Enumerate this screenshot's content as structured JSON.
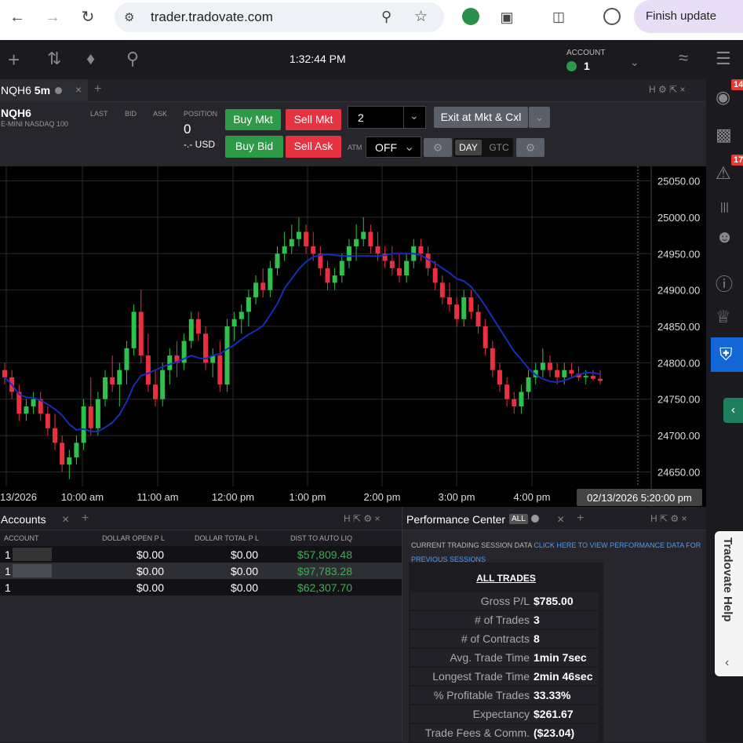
{
  "browser": {
    "url": "trader.tradovate.com",
    "finish_update": "Finish update"
  },
  "topbar": {
    "time": "1:32:44 PM",
    "account_label": "ACCOUNT",
    "account_value": "1"
  },
  "sidebar": {
    "badge_top": "14",
    "badge_mid": "17"
  },
  "chart_tab": {
    "symbol": "NQH6",
    "interval": "5m",
    "add": "+"
  },
  "order": {
    "symbol": "NQH6",
    "description": "E-MINI NASDAQ 100",
    "last_label": "LAST",
    "bid_label": "BID",
    "ask_label": "ASK",
    "position_label": "POSITION",
    "position_value": "0",
    "position_usd": "-.- USD",
    "buy_mkt": "Buy Mkt",
    "sell_mkt": "Sell Mkt",
    "buy_bid": "Buy Bid",
    "sell_ask": "Sell Ask",
    "qty": "2",
    "exit": "Exit at Mkt & Cxl",
    "atm_label": "ATM",
    "atm_value": "OFF",
    "day": "DAY",
    "gtc": "GTC"
  },
  "chart_data": {
    "type": "candlestick",
    "y_ticks": [
      "25050.00",
      "25000.00",
      "24950.00",
      "24900.00",
      "24850.00",
      "24800.00",
      "24750.00",
      "24700.00",
      "24650.00"
    ],
    "ylim": [
      24630,
      25070
    ],
    "x_ticks": [
      "13/2026",
      "10:00 am",
      "11:00 am",
      "12:00 pm",
      "1:00 pm",
      "2:00 pm",
      "3:00 pm",
      "4:00 pm"
    ],
    "crosshair_label": "02/13/2026 5:20:00 pm",
    "ma_color": "#1a2db8",
    "up_color": "#2ec24a",
    "down_color": "#e8303f",
    "candles": [
      [
        24790,
        24800,
        24770,
        24780
      ],
      [
        24780,
        24790,
        24750,
        24760
      ],
      [
        24760,
        24770,
        24720,
        24730
      ],
      [
        24730,
        24750,
        24720,
        24740
      ],
      [
        24740,
        24760,
        24730,
        24750
      ],
      [
        24750,
        24760,
        24720,
        24730
      ],
      [
        24730,
        24740,
        24700,
        24710
      ],
      [
        24710,
        24730,
        24680,
        24690
      ],
      [
        24690,
        24700,
        24650,
        24660
      ],
      [
        24660,
        24680,
        24640,
        24670
      ],
      [
        24670,
        24700,
        24660,
        24690
      ],
      [
        24690,
        24750,
        24680,
        24740
      ],
      [
        24740,
        24780,
        24700,
        24710
      ],
      [
        24710,
        24760,
        24700,
        24750
      ],
      [
        24750,
        24790,
        24740,
        24780
      ],
      [
        24780,
        24810,
        24760,
        24770
      ],
      [
        24770,
        24800,
        24740,
        24790
      ],
      [
        24790,
        24830,
        24770,
        24820
      ],
      [
        24820,
        24880,
        24810,
        24870
      ],
      [
        24870,
        24900,
        24800,
        24810
      ],
      [
        24810,
        24840,
        24760,
        24770
      ],
      [
        24770,
        24790,
        24740,
        24750
      ],
      [
        24750,
        24800,
        24740,
        24790
      ],
      [
        24790,
        24820,
        24770,
        24810
      ],
      [
        24810,
        24830,
        24780,
        24800
      ],
      [
        24800,
        24840,
        24790,
        24830
      ],
      [
        24830,
        24870,
        24820,
        24860
      ],
      [
        24860,
        24870,
        24830,
        24840
      ],
      [
        24840,
        24850,
        24790,
        24800
      ],
      [
        24800,
        24820,
        24780,
        24810
      ],
      [
        24810,
        24830,
        24760,
        24770
      ],
      [
        24770,
        24860,
        24760,
        24850
      ],
      [
        24850,
        24870,
        24830,
        24860
      ],
      [
        24860,
        24880,
        24840,
        24870
      ],
      [
        24870,
        24900,
        24850,
        24890
      ],
      [
        24890,
        24920,
        24880,
        24910
      ],
      [
        24910,
        24930,
        24890,
        24900
      ],
      [
        24900,
        24940,
        24890,
        24930
      ],
      [
        24930,
        24960,
        24920,
        24950
      ],
      [
        24950,
        24980,
        24940,
        24960
      ],
      [
        24960,
        24990,
        24950,
        24970
      ],
      [
        24970,
        25000,
        24960,
        24980
      ],
      [
        24980,
        24990,
        24950,
        24960
      ],
      [
        24960,
        24980,
        24940,
        24950
      ],
      [
        24950,
        24960,
        24920,
        24930
      ],
      [
        24930,
        24940,
        24900,
        24910
      ],
      [
        24910,
        24930,
        24900,
        24920
      ],
      [
        24920,
        24950,
        24910,
        24940
      ],
      [
        24940,
        24970,
        24930,
        24960
      ],
      [
        24960,
        24990,
        24940,
        24970
      ],
      [
        24970,
        25000,
        24960,
        24980
      ],
      [
        24980,
        24990,
        24950,
        24960
      ],
      [
        24960,
        24980,
        24940,
        24950
      ],
      [
        24950,
        24960,
        24930,
        24940
      ],
      [
        24940,
        24960,
        24920,
        24930
      ],
      [
        24930,
        24950,
        24910,
        24920
      ],
      [
        24920,
        24950,
        24910,
        24940
      ],
      [
        24940,
        24970,
        24930,
        24960
      ],
      [
        24960,
        24970,
        24940,
        24950
      ],
      [
        24950,
        24960,
        24920,
        24930
      ],
      [
        24930,
        24940,
        24900,
        24910
      ],
      [
        24910,
        24920,
        24880,
        24890
      ],
      [
        24890,
        24910,
        24870,
        24880
      ],
      [
        24880,
        24890,
        24850,
        24860
      ],
      [
        24860,
        24900,
        24850,
        24890
      ],
      [
        24890,
        24900,
        24860,
        24870
      ],
      [
        24870,
        24880,
        24840,
        24850
      ],
      [
        24850,
        24860,
        24810,
        24820
      ],
      [
        24820,
        24830,
        24780,
        24790
      ],
      [
        24790,
        24800,
        24760,
        24770
      ],
      [
        24770,
        24780,
        24740,
        24750
      ],
      [
        24750,
        24760,
        24730,
        24740
      ],
      [
        24740,
        24770,
        24730,
        24760
      ],
      [
        24760,
        24790,
        24750,
        24780
      ],
      [
        24780,
        24800,
        24770,
        24790
      ],
      [
        24790,
        24820,
        24780,
        24800
      ],
      [
        24800,
        24810,
        24780,
        24790
      ],
      [
        24790,
        24800,
        24770,
        24780
      ],
      [
        24780,
        24800,
        24770,
        24790
      ],
      [
        24790,
        24800,
        24780,
        24785
      ],
      [
        24785,
        24795,
        24775,
        24780
      ],
      [
        24780,
        24790,
        24770,
        24782
      ],
      [
        24782,
        24790,
        24775,
        24778
      ],
      [
        24778,
        24790,
        24770,
        24775
      ]
    ]
  },
  "accounts": {
    "title": "Accounts",
    "headers": [
      "ACCOUNT",
      "DOLLAR OPEN P L",
      "DOLLAR TOTAL P L",
      "DIST TO AUTO LIQ"
    ],
    "rows": [
      [
        "1",
        "$0.00",
        "$0.00",
        "$57,809.48"
      ],
      [
        "1",
        "$0.00",
        "$0.00",
        "$97,783.28"
      ],
      [
        "1",
        "$0.00",
        "$0.00",
        "$62,307.70"
      ]
    ]
  },
  "performance": {
    "title": "Performance Center",
    "all_label": "ALL",
    "session_text": "CURRENT TRADING SESSION DATA",
    "link_text": "CLICK HERE TO VIEW PERFORMANCE DATA FOR PREVIOUS SESSIONS",
    "heading": "ALL TRADES",
    "stats": [
      {
        "label": "Gross P/L",
        "value": "$785.00"
      },
      {
        "label": "# of Trades",
        "value": "3"
      },
      {
        "label": "# of Contracts",
        "value": "8"
      },
      {
        "label": "Avg. Trade Time",
        "value": "1min 7sec"
      },
      {
        "label": "Longest Trade Time",
        "value": "2min 46sec"
      },
      {
        "label": "% Profitable Trades",
        "value": "33.33%"
      },
      {
        "label": "Expectancy",
        "value": "$261.67"
      },
      {
        "label": "Trade Fees & Comm.",
        "value": "($23.04)"
      }
    ]
  },
  "help": {
    "label": "Tradovate Help"
  }
}
